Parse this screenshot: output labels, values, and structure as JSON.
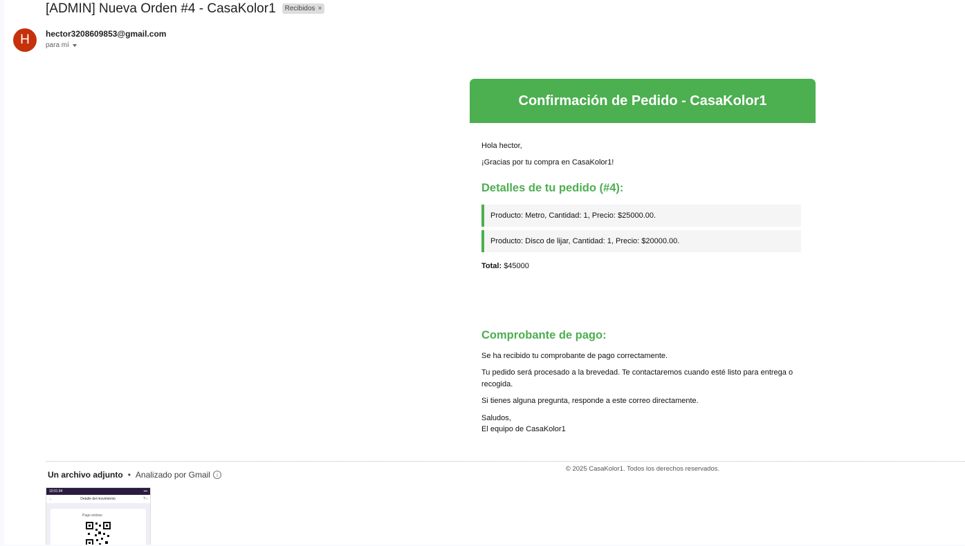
{
  "subject": "[ADMIN] Nueva Orden #4 - CasaKolor1",
  "label": "Recibidos",
  "sender": {
    "initial": "H",
    "email": "hector3208609853@gmail.com",
    "to": "para mí"
  },
  "email": {
    "header_title": "Confirmación de Pedido - CasaKolor1",
    "greeting": "Hola hector,",
    "thanks": "¡Gracias por tu compra en CasaKolor1!",
    "details_heading": "Detalles de tu pedido (#4):",
    "items": [
      "Producto: Metro, Cantidad: 1, Precio: $25000.00.",
      "Producto: Disco de lijar, Cantidad: 1, Precio: $20000.00."
    ],
    "total_label": "Total:",
    "total_value": "$45000",
    "receipt_heading": "Comprobante de pago:",
    "receipt_text": "Se ha recibido tu comprobante de pago correctamente.",
    "processing_line1": "Tu pedido será procesado a la brevedad. Te contactaremos cuando esté listo para entrega o",
    "processing_line2": "recogida.",
    "questions": "Si tienes alguna pregunta, responde a este correo directamente.",
    "regards": "Saludos,",
    "team": "El equipo de CasaKolor1",
    "footer": "© 2025 CasaKolor1. Todos los derechos reservados."
  },
  "attachments": {
    "title": "Un archivo adjunto",
    "analyzed": "Analizado por Gmail",
    "thumb": {
      "status_time": "10:01 84",
      "screen_title": "Detalle del movimiento",
      "page_label": "Pago exitoso"
    }
  },
  "colors": {
    "accent_green": "#4caf50",
    "avatar_bg": "#c5310b"
  },
  "icons": [
    "close-icon",
    "chevron-down-icon",
    "info-icon",
    "back-arrow-icon",
    "qr-code-icon"
  ]
}
